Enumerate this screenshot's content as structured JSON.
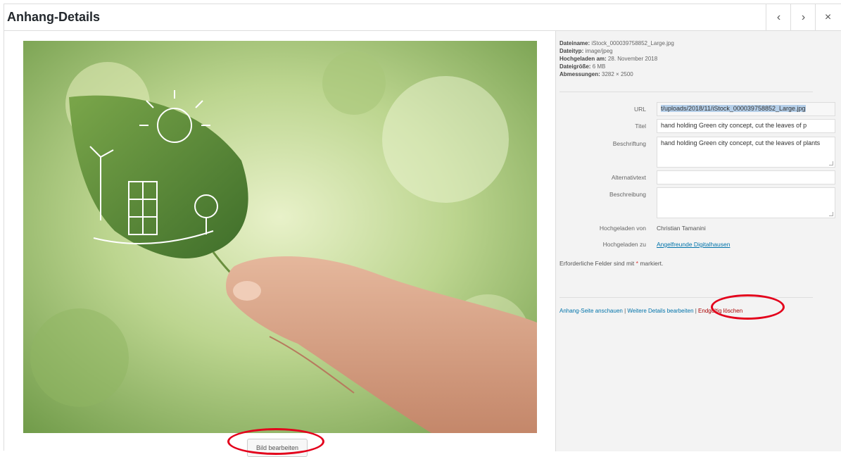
{
  "header": {
    "title": "Anhang-Details"
  },
  "nav": {
    "prev_icon": "‹",
    "next_icon": "›",
    "close_icon": "×"
  },
  "left": {
    "edit_button": "Bild bearbeiten"
  },
  "file_info": {
    "name_label": "Dateiname:",
    "name": "iStock_000039758852_Large.jpg",
    "type_label": "Dateityp:",
    "type": "image/jpeg",
    "uploaded_label": "Hochgeladen am:",
    "uploaded": "28. November 2018",
    "size_label": "Dateigröße:",
    "size": "6 MB",
    "dims_label": "Abmessungen:",
    "dims": "3282 × 2500"
  },
  "fields": {
    "url_label": "URL",
    "url_value": "t/uploads/2018/11/iStock_000039758852_Large.jpg",
    "title_label": "Titel",
    "title_value": "hand holding Green city concept, cut the leaves of p",
    "caption_label": "Beschriftung",
    "caption_value": "hand holding Green city concept, cut the leaves of plants",
    "alt_label": "Alternativtext",
    "alt_value": "",
    "desc_label": "Beschreibung",
    "desc_value": "",
    "uploaded_by_label": "Hochgeladen von",
    "uploaded_by": "Christian Tamanini",
    "uploaded_to_label": "Hochgeladen zu",
    "uploaded_to": "Angelfreunde Digitalhausen"
  },
  "required_note": {
    "before": "Erforderliche Felder sind mit ",
    "star": "*",
    "after": " markiert."
  },
  "actions": {
    "view": "Anhang-Seite anschauen",
    "sep1": " | ",
    "edit": "Weitere Details bearbeiten",
    "sep2": " | ",
    "delete": "Endgültig löschen"
  },
  "colors": {
    "annotation": "#e3001b",
    "link": "#0073aa",
    "delete": "#aa0000"
  }
}
